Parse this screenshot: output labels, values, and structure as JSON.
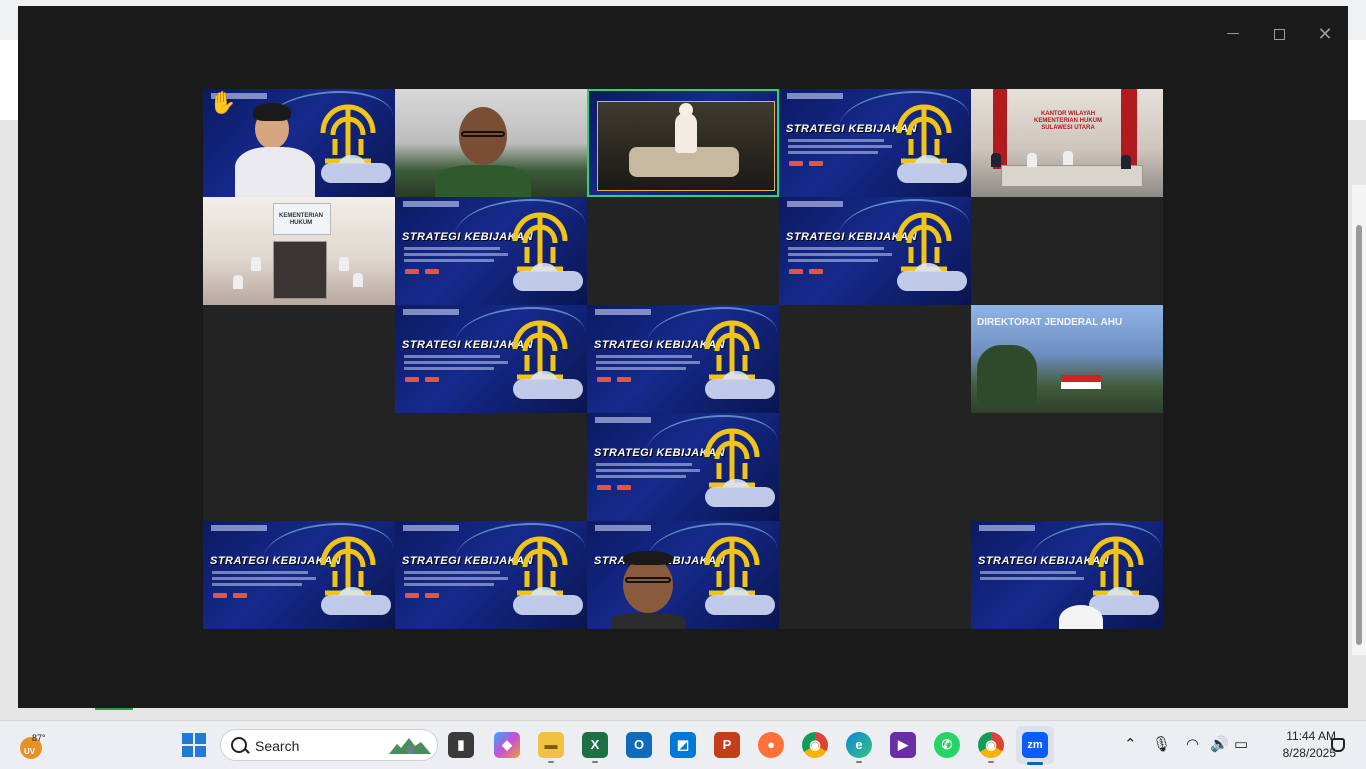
{
  "window": {
    "controls": {
      "minimize": "",
      "maximize": "",
      "close": "✕"
    }
  },
  "gallery": {
    "share_title": "STRATEGI KEBIJAKAN",
    "building_sign": "DIREKTORAT JENDERAL AHU",
    "room_sign_1": "KANTOR WILAYAH KEMENTERIAN HUKUM SULAWESI UTARA",
    "room_sign_2": "KEMENTERIAN HUKUM"
  },
  "taskbar": {
    "weather_temp": "87°",
    "weather_uv": "UV",
    "search_label": "Search",
    "clock_time": "11:44 AM",
    "clock_date": "8/28/2025",
    "apps": [
      {
        "name": "task-view",
        "glyph": "▮"
      },
      {
        "name": "copilot",
        "glyph": "◆"
      },
      {
        "name": "file-explorer",
        "glyph": "▬"
      },
      {
        "name": "excel",
        "glyph": "X"
      },
      {
        "name": "outlook",
        "glyph": "O"
      },
      {
        "name": "azure-data-studio",
        "glyph": "◩"
      },
      {
        "name": "powerpoint",
        "glyph": "P"
      },
      {
        "name": "firefox",
        "glyph": "●"
      },
      {
        "name": "chrome",
        "glyph": "◉"
      },
      {
        "name": "edge",
        "glyph": "e"
      },
      {
        "name": "visual-studio",
        "glyph": "▶"
      },
      {
        "name": "whatsapp",
        "glyph": "✆"
      },
      {
        "name": "chrome-profile",
        "glyph": "◉"
      },
      {
        "name": "zoom",
        "glyph": "zm"
      }
    ],
    "colors": {
      "excel": "#1d7044",
      "outlook": "#0f6cbd",
      "azure": "#0078d4",
      "powerpoint": "#c43e1c",
      "firefox": "#ff7139",
      "chrome": "#dd4b39",
      "edge": "#0f87d6",
      "vs": "#6a2ea4",
      "whatsapp": "#25d366",
      "zoom": "#0b5cff"
    }
  }
}
